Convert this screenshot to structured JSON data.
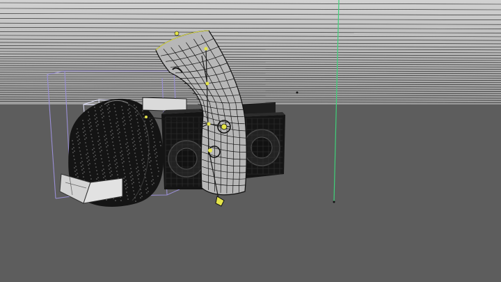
{
  "viewport": {
    "view_mode": "perspective",
    "display_mode": "wireframe",
    "colors": {
      "background": "#5d5d5d",
      "horizon_top": "#c9c9c9",
      "horizon_bottom": "#9a9a9a",
      "grid_line": "#1a1a1a",
      "wire": "#111111",
      "mesh_fill": "#b5b5b5",
      "bounding_box": "#9a8fd6",
      "axis_green": "#3fd27a",
      "selection_yellow": "#e4e44a"
    }
  },
  "scene_objects": [
    {
      "name": "bent-pipe-mesh",
      "type": "mesh",
      "selected": true
    },
    {
      "name": "speaker-box-left",
      "type": "mesh",
      "selected": false
    },
    {
      "name": "speaker-box-right",
      "type": "mesh",
      "selected": false
    },
    {
      "name": "hooded-figure-mesh",
      "type": "mesh",
      "selected": false
    },
    {
      "name": "open-laptop-mesh",
      "type": "mesh",
      "selected": false
    }
  ],
  "icons": {
    "bone_joint": "bone-joint-icon",
    "ik_handle": "ik-handle-icon"
  }
}
